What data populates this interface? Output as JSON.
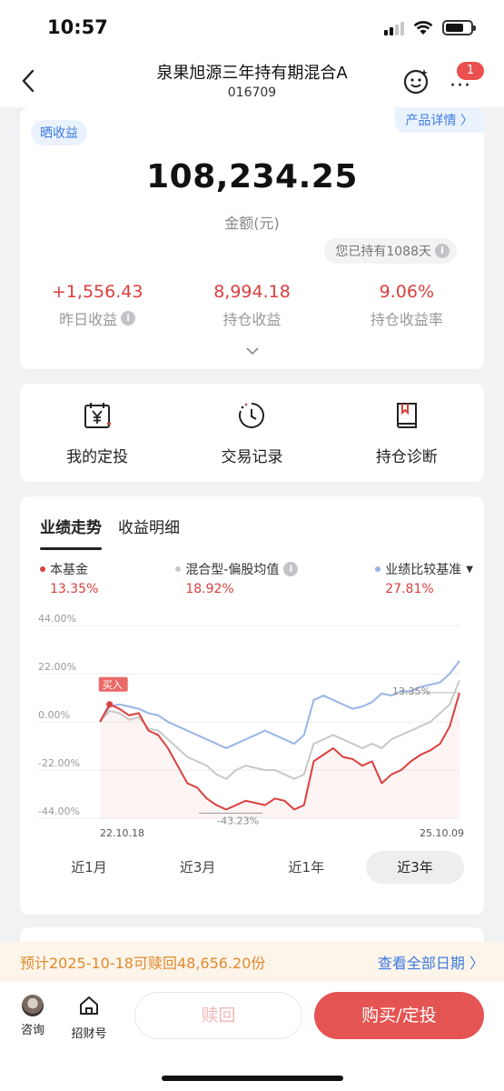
{
  "status": {
    "time": "10:57"
  },
  "nav": {
    "title": "泉果旭源三年持有期混合A",
    "code": "016709",
    "badge": "1"
  },
  "summary": {
    "share_tag": "晒收益",
    "detail_link": "产品详情 〉",
    "amount": "108,234.25",
    "amount_label": "金额(元)",
    "held_days": "您已持有1088天",
    "stats": [
      {
        "value": "+1,556.43",
        "label": "昨日收益",
        "info": true
      },
      {
        "value": "8,994.18",
        "label": "持仓收益",
        "info": false
      },
      {
        "value": "9.06%",
        "label": "持仓收益率",
        "info": false
      }
    ]
  },
  "actions": [
    {
      "label": "我的定投",
      "icon": "calendar-yuan-icon"
    },
    {
      "label": "交易记录",
      "icon": "history-clock-icon"
    },
    {
      "label": "持仓诊断",
      "icon": "book-icon"
    }
  ],
  "chart_section": {
    "tabs": [
      "业绩走势",
      "收益明细"
    ],
    "active_tab": 0,
    "ranges": [
      "近1月",
      "近3月",
      "近1年",
      "近3年"
    ],
    "active_range": 3
  },
  "chart_data": {
    "type": "line",
    "ylim": [
      -44,
      44
    ],
    "yticks": [
      "44.00%",
      "22.00%",
      "0.00%",
      "-22.00%",
      "-44.00%"
    ],
    "x_start": "22.10.18",
    "x_end": "25.10.09",
    "buy_marker": "买入",
    "annotations": {
      "min": "-43.23%",
      "end": "13.35%"
    },
    "series": [
      {
        "name": "本基金",
        "value": "13.35%",
        "color": "#d9403e",
        "values": [
          0,
          8,
          6,
          3,
          4,
          -4,
          -6,
          -12,
          -20,
          -28,
          -30,
          -35,
          -38,
          -40,
          -38,
          -36,
          -37,
          -38,
          -35,
          -36,
          -40,
          -38,
          -18,
          -15,
          -12,
          -16,
          -17,
          -20,
          -18,
          -28,
          -24,
          -22,
          -18,
          -15,
          -13,
          -10,
          -2,
          13.35
        ]
      },
      {
        "name": "混合型-偏股均值",
        "value": "18.92%",
        "color": "#c8c8c8",
        "values": [
          0,
          5,
          4,
          1,
          2,
          -3,
          -4,
          -8,
          -12,
          -16,
          -18,
          -20,
          -24,
          -26,
          -22,
          -20,
          -21,
          -22,
          -22,
          -24,
          -26,
          -24,
          -10,
          -8,
          -6,
          -8,
          -10,
          -12,
          -10,
          -12,
          -8,
          -6,
          -4,
          -2,
          0,
          4,
          8,
          18.92
        ]
      },
      {
        "name": "业绩比较基准",
        "value": "27.81%",
        "color": "#98b5e6",
        "values": [
          0,
          7,
          8,
          7,
          6,
          4,
          3,
          0,
          -2,
          -4,
          -6,
          -8,
          -10,
          -12,
          -10,
          -8,
          -6,
          -4,
          -6,
          -8,
          -10,
          -6,
          10,
          12,
          10,
          8,
          6,
          7,
          9,
          13,
          12,
          14,
          14,
          16,
          17,
          18,
          22,
          27.81
        ]
      }
    ]
  },
  "redeem": {
    "text": "预计2025-10-18可赎回48,656.20份",
    "link": "查看全部日期 〉"
  },
  "bottom": {
    "consult": "咨询",
    "zhaocai": "招财号",
    "sell": "赎回",
    "buy": "购买/定投"
  }
}
